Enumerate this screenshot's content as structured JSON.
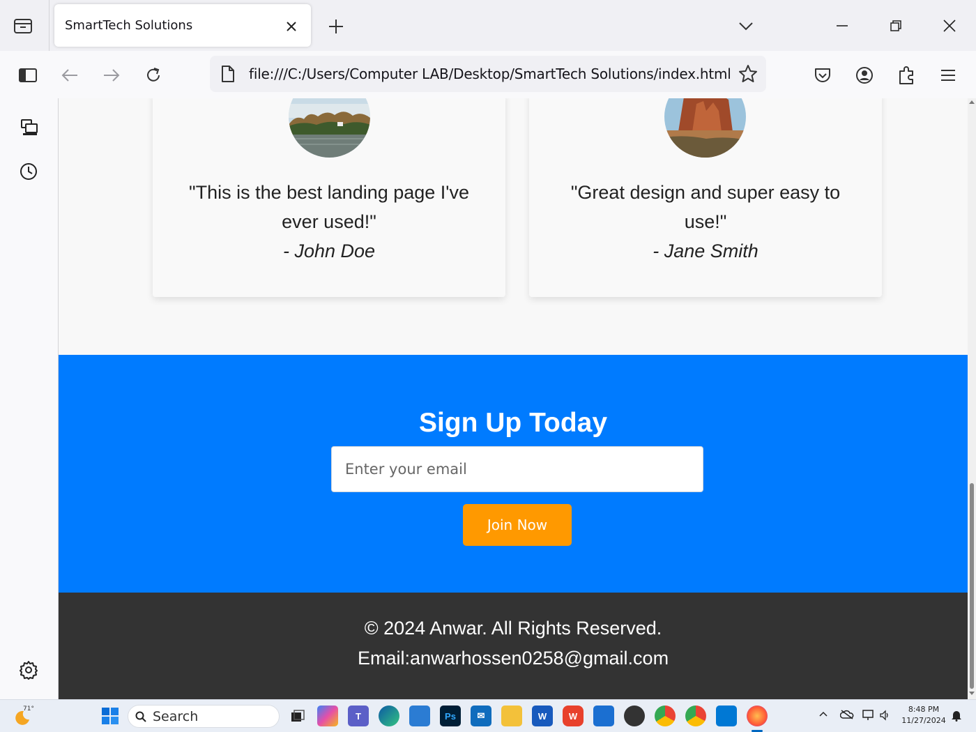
{
  "browser": {
    "tab": {
      "title": "SmartTech Solutions"
    },
    "url": "file:///C:/Users/Computer LAB/Desktop/SmartTech Solutions/index.html"
  },
  "page": {
    "testimonials": [
      {
        "quote_line1": "\"This is the best landing page I've",
        "quote_line2": "ever used!\"",
        "author": "- John Doe"
      },
      {
        "quote_line1": "\"Great design and super easy to",
        "quote_line2": "use!\"",
        "author": "- Jane Smith"
      }
    ],
    "signup": {
      "title": "Sign Up Today",
      "email_placeholder": "Enter your email",
      "button_label": "Join Now"
    },
    "footer": {
      "copyright": "© 2024 Anwar. All Rights Reserved.",
      "email": "Email:anwarhossen0258@gmail.com"
    }
  },
  "taskbar": {
    "weather": "71°",
    "search_label": "Search",
    "time": "8:48 PM",
    "date": "11/27/2024"
  },
  "colors": {
    "signup_bg": "#007bff",
    "button_bg": "#ff9900",
    "footer_bg": "#333333"
  }
}
